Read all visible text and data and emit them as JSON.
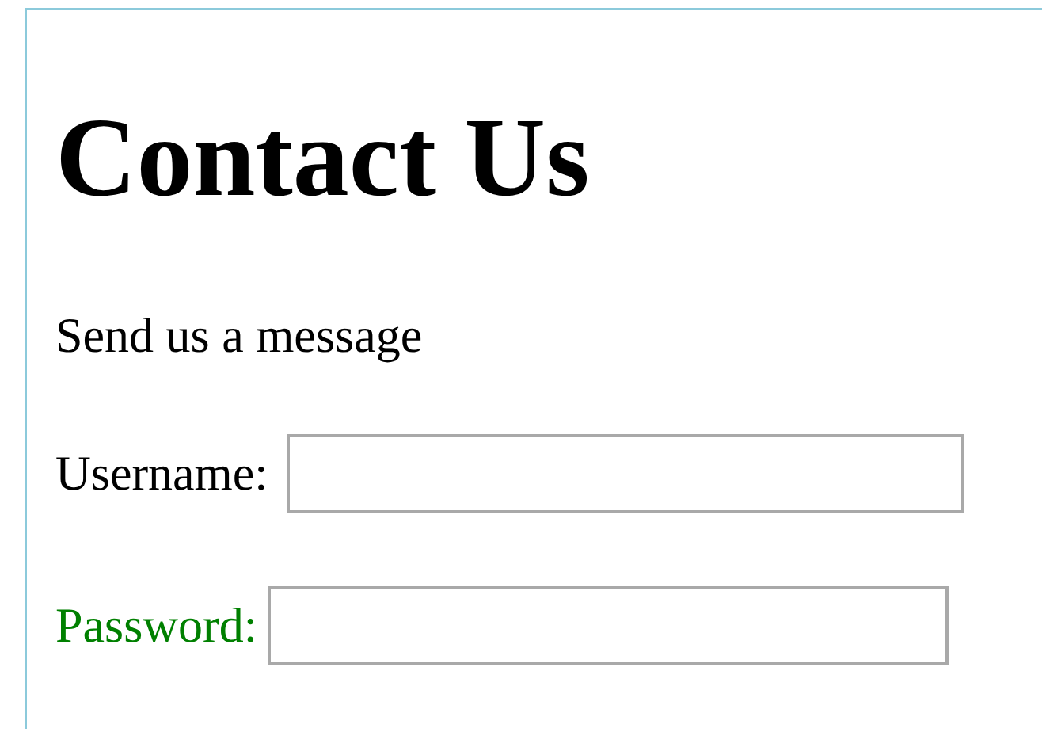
{
  "heading": "Contact Us",
  "intro": "Send us a message",
  "fields": [
    {
      "label": "Username:",
      "color": "#000000"
    },
    {
      "label": "Password:",
      "color": "#008000"
    }
  ]
}
